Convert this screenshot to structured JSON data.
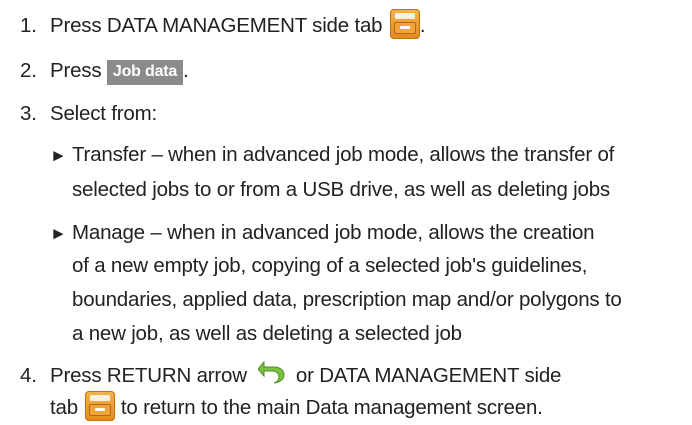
{
  "steps": [
    {
      "number": "1.",
      "text_before": "Press DATA MANAGEMENT side tab",
      "text_after": "."
    },
    {
      "number": "2.",
      "text_before": "Press",
      "button_label": "Job data",
      "text_after": "."
    },
    {
      "number": "3.",
      "text": "Select from:"
    },
    {
      "number": "4.",
      "line1_before": "Press RETURN arrow",
      "line1_after": "or DATA MANAGEMENT side",
      "line2_before": "tab",
      "line2_after": "to return to the main Data management screen."
    }
  ],
  "options": [
    {
      "marker": "►",
      "lines": [
        "Transfer – when in advanced job mode, allows the transfer of",
        "selected jobs to or from a USB drive, as well as deleting jobs"
      ]
    },
    {
      "marker": "►",
      "lines": [
        "Manage – when in advanced job mode, allows the creation",
        "of a new empty job, copying of a selected job's guidelines,",
        "boundaries, applied data, prescription map and/or polygons to",
        "a new job, as well as deleting a selected job"
      ]
    }
  ],
  "icons": {
    "data_management_tab": "file-cabinet-icon",
    "return_arrow": "return-arrow-icon"
  },
  "colors": {
    "button_bg": "#8b8b8b",
    "cabinet_orange": "#e89a2c",
    "return_green": "#7cc242"
  }
}
